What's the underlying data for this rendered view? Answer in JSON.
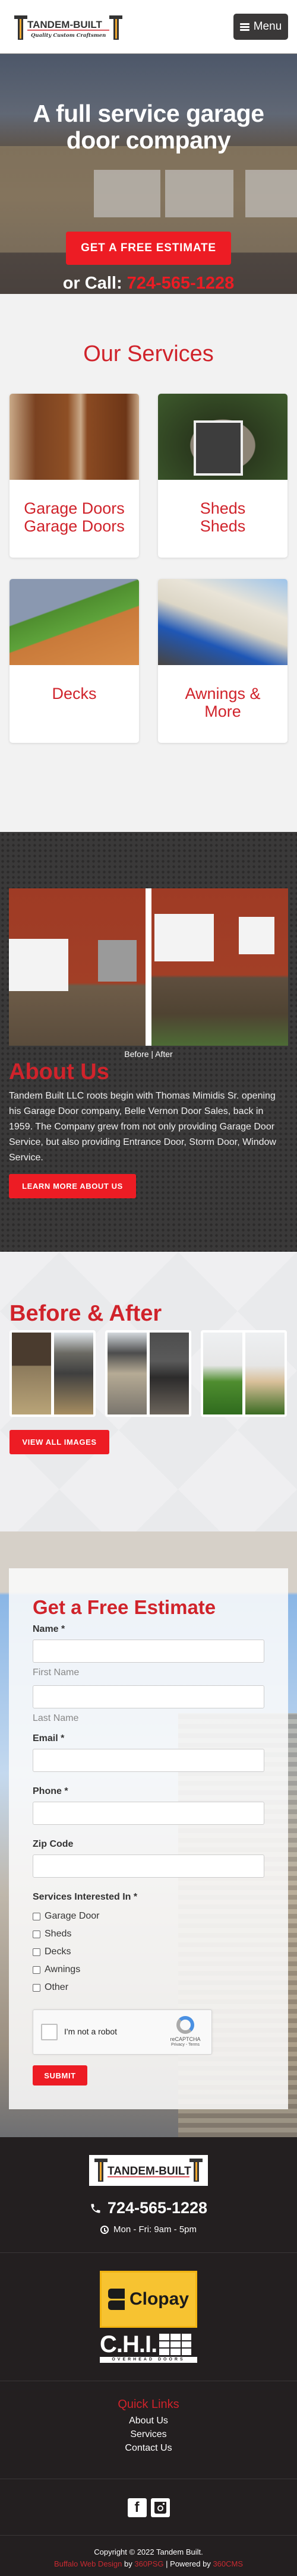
{
  "header": {
    "logo_text": "TANDEM-BUILT",
    "logo_tagline": "Quality Custom Craftsmen",
    "menu_label": "Menu"
  },
  "hero": {
    "title": "A full service garage door company",
    "cta_label": "GET A FREE ESTIMATE",
    "call_prefix": "or Call:",
    "phone": "724-565-1228"
  },
  "services": {
    "title": "Our Services",
    "items": [
      {
        "title_line1": "Garage Doors",
        "title_line2": "Garage Doors"
      },
      {
        "title_line1": "Sheds",
        "title_line2": "Sheds"
      },
      {
        "title_line1": "Decks",
        "title_line2": ""
      },
      {
        "title_line1": "Awnings &",
        "title_line2": "More"
      }
    ]
  },
  "about": {
    "image_caption": "Before | After",
    "title": "About Us",
    "text": "Tandem Built LLC roots begin with Thomas Mimidis Sr. opening his Garage Door company, Belle Vernon Door Sales, back in 1959.  The Company grew from not only providing Garage Door Service, but also providing Entrance Door, Storm Door, Window Service.",
    "button_label": "LEARN MORE ABOUT US"
  },
  "gallery": {
    "title": "Before & After",
    "button_label": "VIEW ALL IMAGES"
  },
  "estimate_form": {
    "title": "Get a Free Estimate",
    "name_label": "Name *",
    "first_name_sublabel": "First Name",
    "last_name_sublabel": "Last Name",
    "email_label": "Email *",
    "phone_label": "Phone *",
    "zip_label": "Zip Code",
    "services_label": "Services Interested In *",
    "service_options": [
      "Garage Door",
      "Sheds",
      "Decks",
      "Awnings",
      "Other"
    ],
    "recaptcha_label": "I'm not a robot",
    "recaptcha_brand": "reCAPTCHA",
    "recaptcha_links": "Privacy - Terms",
    "submit_label": "SUBMIT"
  },
  "footer": {
    "logo_text": "TANDEM-BUILT",
    "phone": "724-565-1228",
    "hours": "Mon - Fri: 9am - 5pm",
    "partner_clopay": "Clopay",
    "partner_chi": "C.H.I.",
    "partner_chi_sub": "OVERHEAD DOORS",
    "quick_links_title": "Quick Links",
    "quick_links": [
      "About Us",
      "Services",
      "Contact Us"
    ],
    "social": [
      "facebook",
      "instagram"
    ],
    "copyright": "Copyright © 2022 Tandem Built.",
    "credit_link1": "Buffalo Web Design",
    "credit_by": "by",
    "credit_link2": "360PSG",
    "credit_powered": "| Powered by",
    "credit_link3": "360CMS"
  },
  "colors": {
    "brand_red": "#ed1c24",
    "heading_red": "#d0232b",
    "dark": "#231f20"
  }
}
